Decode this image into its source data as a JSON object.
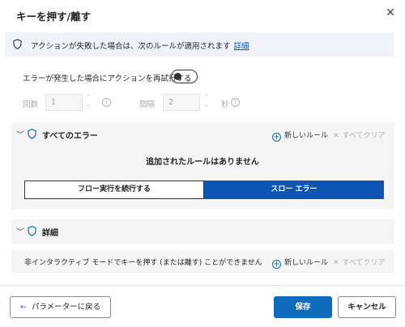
{
  "dialog": {
    "title": "キーを押す/離す",
    "close_glyph": "✕"
  },
  "info_bar": {
    "text": "アクションが失敗した場合は、次のルールが適用されます",
    "link": "詳細"
  },
  "retry": {
    "label": "エラーが発生した場合にアクションを再試行する",
    "enabled": false,
    "count_label": "回数",
    "count_value": "1",
    "interval_label": "間隔",
    "interval_value": "2",
    "seconds_label": "秒"
  },
  "all_errors": {
    "title": "すべてのエラー",
    "new_rule": "新しいルール",
    "clear_all": "すべてクリア",
    "no_rules": "追加されたルールはありません",
    "options": [
      "フロー実行を続行する",
      "スロー エラー"
    ],
    "selected_index": 1
  },
  "details": {
    "title": "詳細",
    "row_text": "非インタラクティブ モードでキーを押す (または離す) ことができません",
    "new_rule": "新しいルール",
    "clear_all": "すべてクリア"
  },
  "footer": {
    "back": "パラメーターに戻る",
    "save": "保存",
    "cancel": "キャンセル"
  },
  "colors": {
    "accent": "#0f6cbd",
    "selected": "#0f55b4",
    "panel": "#f5f5f5"
  },
  "icons": [
    "shield-icon",
    "close-icon",
    "chevron-down-icon",
    "plus-circle-icon",
    "info-icon",
    "arrow-left-icon"
  ]
}
